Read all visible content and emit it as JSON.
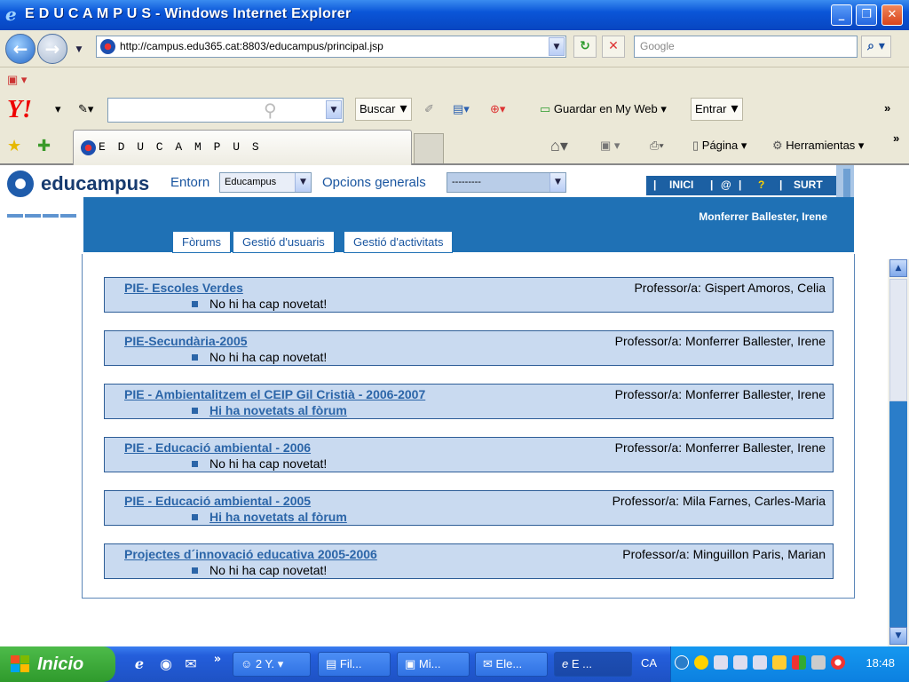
{
  "window": {
    "title": "E D U C A M P U S - Windows Internet Explorer",
    "minimize": "_",
    "maximize": "❐",
    "close": "✕"
  },
  "addressbar": {
    "url": "http://campus.edu365.cat:8803/educampus/principal.jsp",
    "search_placeholder": "Google"
  },
  "toolbar": {
    "buscar": "Buscar",
    "guardar": "Guardar en My Web",
    "entrar": "Entrar",
    "more": "»",
    "pagina": "Página",
    "herramientas": "Herramientas"
  },
  "browser_tab": {
    "title": "E D U C A M P U S"
  },
  "site": {
    "logo_text": "educampus",
    "entorn_label": "Entorn",
    "entorn_value": "Educampus",
    "opcions_label": "Opcions generals",
    "opcions_value": "---------",
    "topnav": [
      "INICI",
      "@",
      "?",
      "SURT"
    ],
    "user_name": "Monferrer Ballester, Irene",
    "tabs": [
      "Fòrums",
      "Gestió d'usuaris",
      "Gestió d'activitats"
    ]
  },
  "courses": [
    {
      "name": "PIE- Escoles Verdes",
      "teacher": "Professor/a: Gispert Amoros, Celia",
      "status": "No hi ha cap novetat!",
      "status_link": false
    },
    {
      "name": "PIE-Secundària-2005",
      "teacher": "Professor/a: Monferrer Ballester, Irene",
      "status": "No hi ha cap novetat!",
      "status_link": false
    },
    {
      "name": "PIE - Ambientalitzem el CEIP Gil Cristià - 2006-2007",
      "teacher": "Professor/a: Monferrer Ballester, Irene",
      "status": "Hi ha novetats al fòrum",
      "status_link": true
    },
    {
      "name": "PIE - Educació ambiental - 2006",
      "teacher": "Professor/a: Monferrer Ballester, Irene",
      "status": "No hi ha cap novetat!",
      "status_link": false
    },
    {
      "name": "PIE - Educació ambiental - 2005",
      "teacher": "Professor/a: Mila Farnes, Carles-Maria",
      "status": "Hi ha novetats al fòrum",
      "status_link": true
    },
    {
      "name": "Projectes d´innovació educativa 2005-2006",
      "teacher": "Professor/a: Minguillon Paris, Marian",
      "status": "No hi ha cap novetat!",
      "status_link": false
    }
  ],
  "taskbar": {
    "start": "Inicio",
    "tasks": [
      "2 Y.",
      "Fil...",
      "Mi...",
      "Ele...",
      "E ..."
    ],
    "lang": "CA",
    "clock": "18:48",
    "overflow": "»"
  }
}
